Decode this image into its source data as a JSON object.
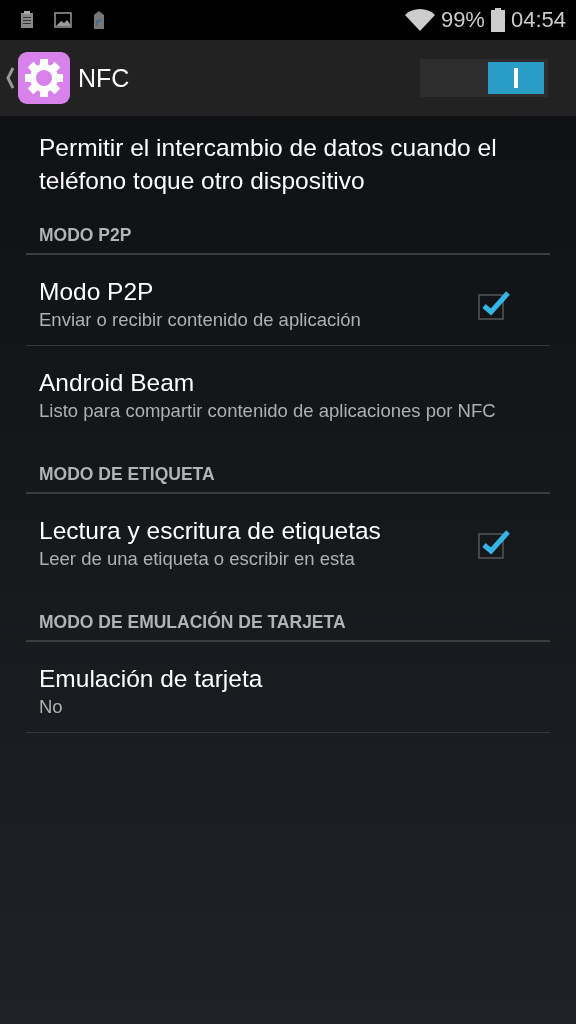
{
  "status_bar": {
    "battery": "99%",
    "time": "04:54"
  },
  "action_bar": {
    "title": "NFC",
    "switch": {
      "on": true
    }
  },
  "description": "Permitir el intercambio de datos cuando el teléfono toque otro dispositivo",
  "sections": [
    {
      "header": "MODO P2P",
      "items": [
        {
          "kind": "checkbox",
          "title": "Modo P2P",
          "summary": "Enviar o recibir contenido de aplicación",
          "checked": true
        },
        {
          "kind": "plain",
          "title": "Android Beam",
          "summary": "Listo para compartir contenido de aplicaciones por NFC"
        }
      ]
    },
    {
      "header": "MODO DE ETIQUETA",
      "items": [
        {
          "kind": "checkbox",
          "title": "Lectura y escritura de etiquetas",
          "summary": "Leer de una etiqueta o escribir en esta",
          "checked": true
        }
      ]
    },
    {
      "header": "MODO DE EMULACIÓN DE TARJETA",
      "items": [
        {
          "kind": "plain",
          "title": "Emulación de tarjeta",
          "summary": "No"
        }
      ]
    }
  ]
}
